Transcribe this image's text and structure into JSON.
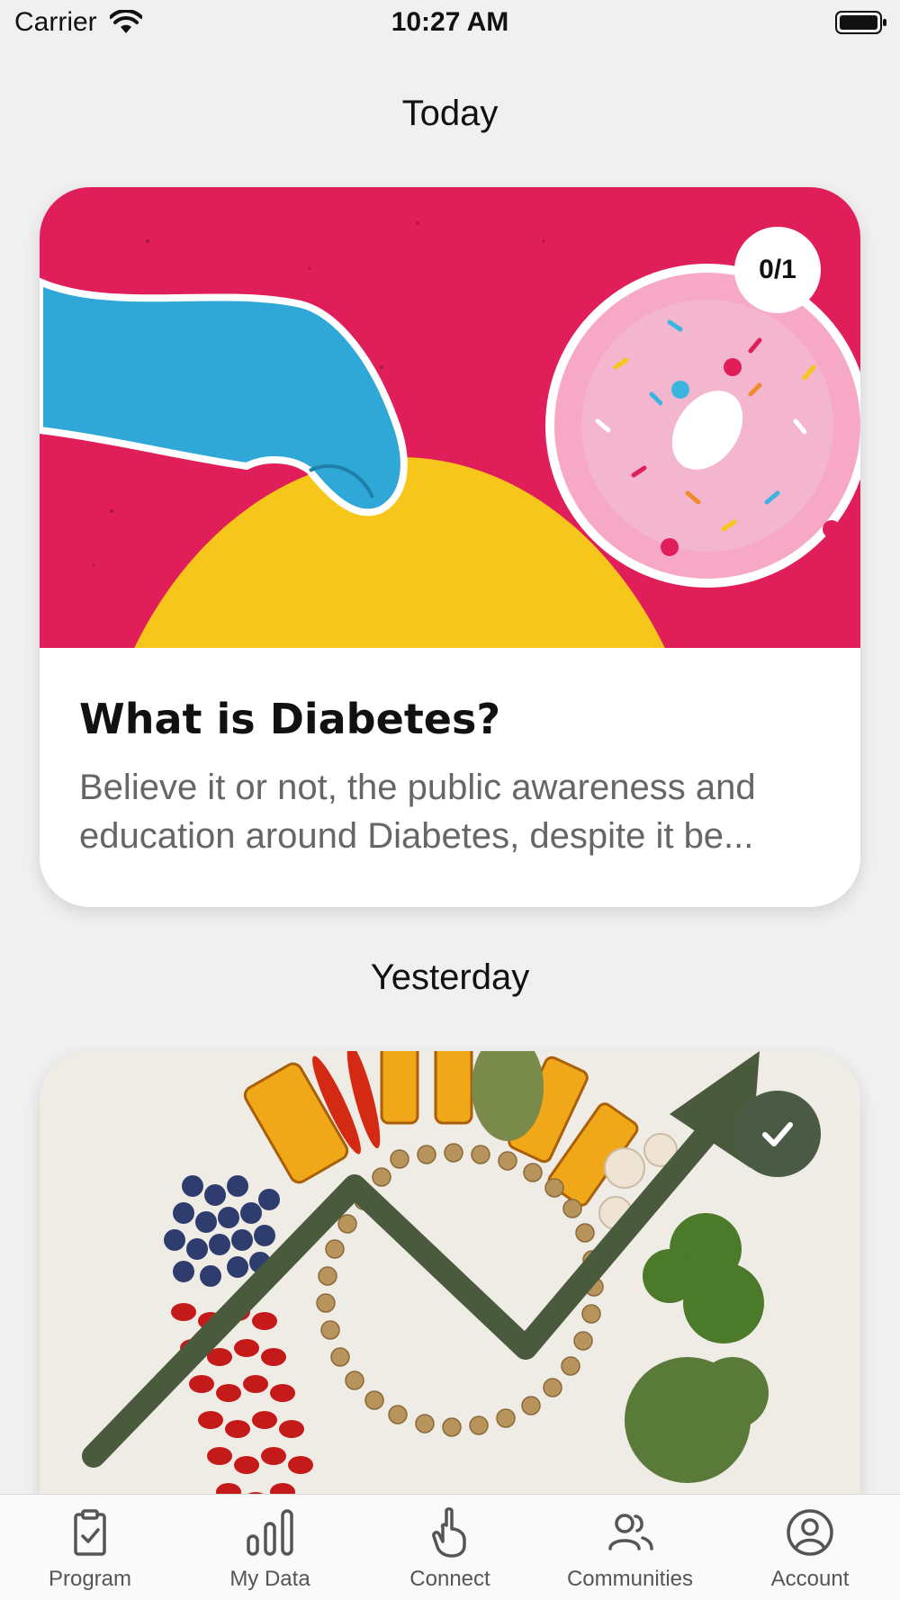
{
  "status_bar": {
    "carrier": "Carrier",
    "time": "10:27 AM"
  },
  "sections": {
    "today": "Today",
    "yesterday": "Yesterday"
  },
  "cards": [
    {
      "badge": "0/1",
      "title": "What is Diabetes?",
      "description": "Believe it or not, the public awareness and education around Diabetes, despite it be..."
    },
    {
      "badge_icon": "checkmark-icon"
    }
  ],
  "tab_bar": {
    "items": [
      {
        "label": "Program",
        "icon": "clipboard-check-icon"
      },
      {
        "label": "My Data",
        "icon": "bar-chart-icon"
      },
      {
        "label": "Connect",
        "icon": "hand-pointer-icon"
      },
      {
        "label": "Communities",
        "icon": "people-icon"
      },
      {
        "label": "Account",
        "icon": "user-circle-icon"
      }
    ]
  },
  "colors": {
    "card1_background": "#e01e5a",
    "sun": "#f7c61a",
    "hand": "#2fa8d8",
    "donut": "#f4a0c0",
    "check_badge": "#4a5a44",
    "arrow": "#4a5a3c"
  }
}
